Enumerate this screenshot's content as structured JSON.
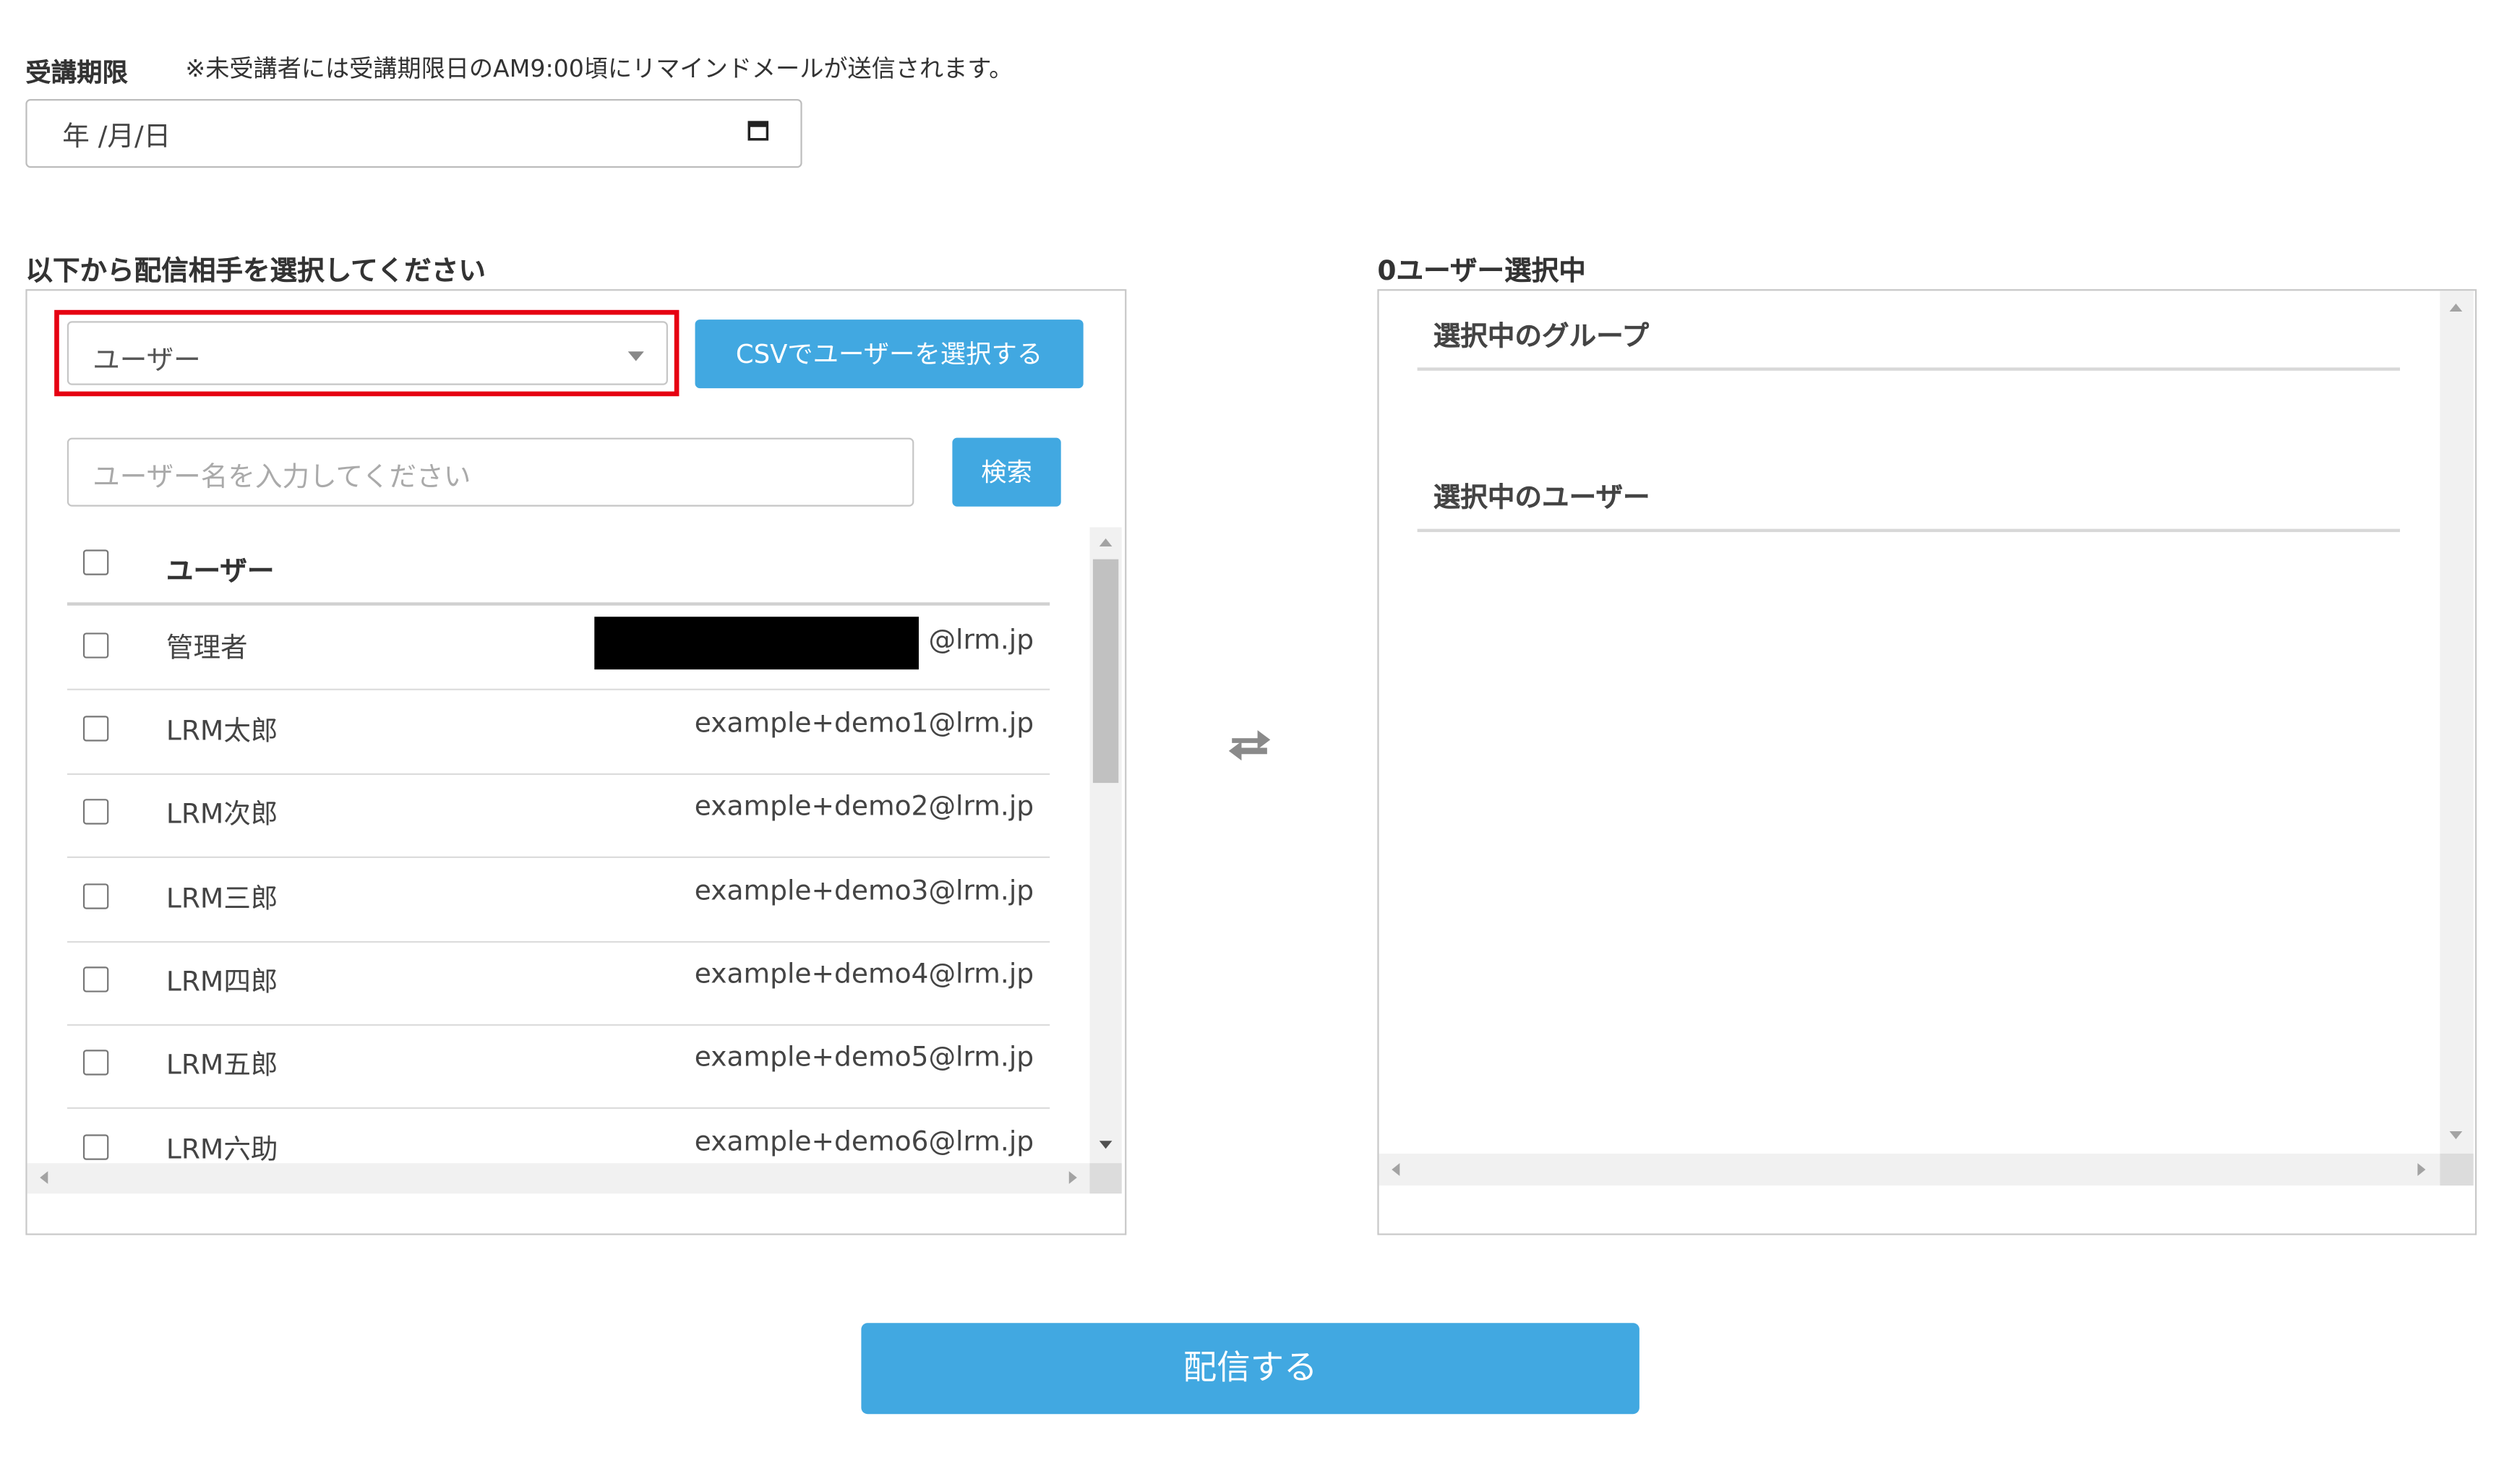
{
  "deadline": {
    "label": "受講期限",
    "note": "※未受講者には受講期限日のAM9:00頃にリマインドメールが送信されます。",
    "date_placeholder": "年 /月/日",
    "calendar_icon": "calendar-icon"
  },
  "left_panel": {
    "title": "以下から配信相手を選択してください",
    "select_value": "ユーザー",
    "csv_button": "CSVでユーザーを選択する",
    "search_placeholder": "ユーザー名を入力してください",
    "search_button": "検索",
    "table": {
      "header": "ユーザー",
      "rows": [
        {
          "name": "管理者",
          "email": "@lrm.jp",
          "redacted": true
        },
        {
          "name": "LRM太郎",
          "email": "example+demo1@lrm.jp"
        },
        {
          "name": "LRM次郎",
          "email": "example+demo2@lrm.jp"
        },
        {
          "name": "LRM三郎",
          "email": "example+demo3@lrm.jp"
        },
        {
          "name": "LRM四郎",
          "email": "example+demo4@lrm.jp"
        },
        {
          "name": "LRM五郎",
          "email": "example+demo5@lrm.jp"
        },
        {
          "name": "LRM六助",
          "email": "example+demo6@lrm.jp"
        }
      ]
    }
  },
  "transfer_icon": "swap-arrows-icon",
  "right_panel": {
    "title": "0ユーザー選択中",
    "groups_heading": "選択中のグループ",
    "users_heading": "選択中のユーザー"
  },
  "submit_button": "配信する",
  "colors": {
    "accent": "#41a8e1",
    "highlight": "#e60012"
  }
}
